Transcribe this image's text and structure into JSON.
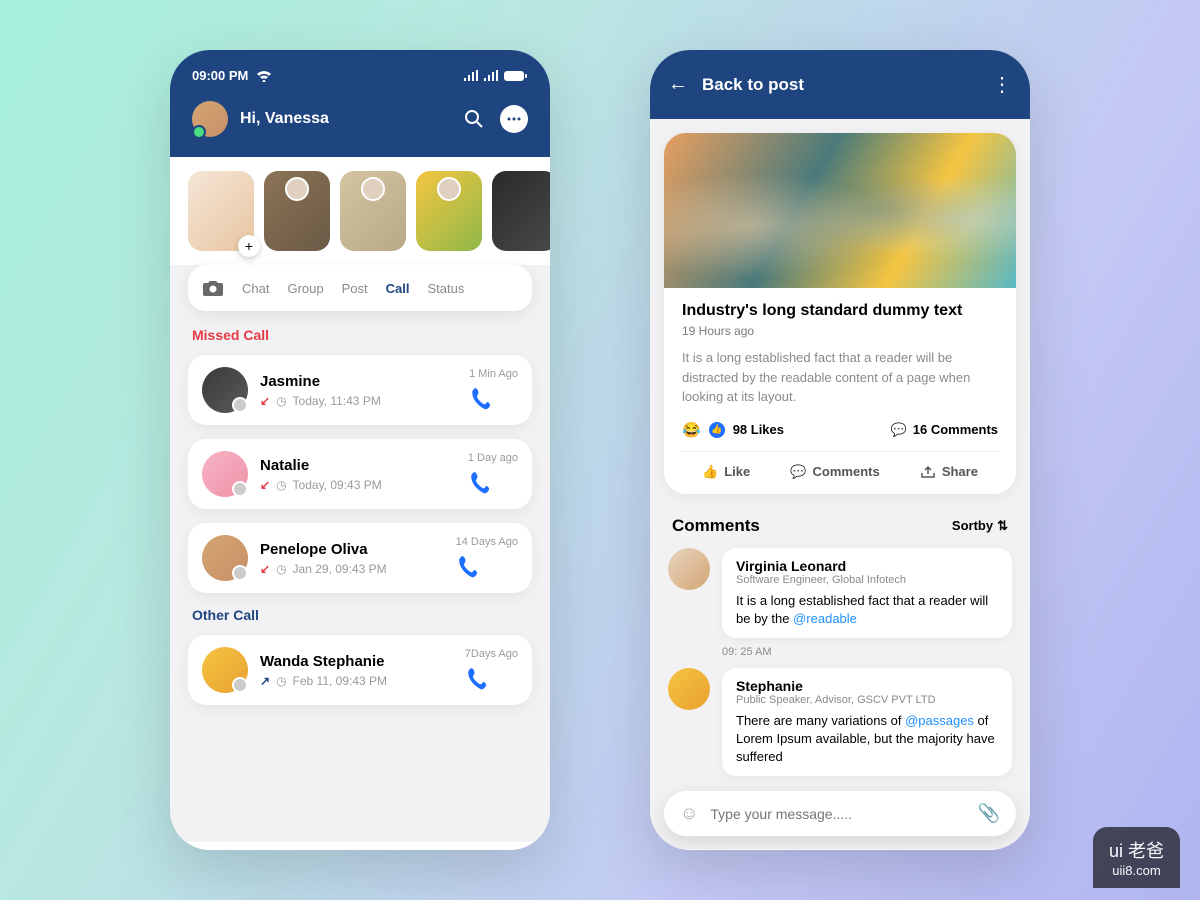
{
  "phone1": {
    "status_time": "09:00 PM",
    "greeting": "Hi, Vanessa",
    "tabs": {
      "chat": "Chat",
      "group": "Group",
      "post": "Post",
      "call": "Call",
      "status": "Status"
    },
    "missed_header": "Missed Call",
    "other_header": "Other Call",
    "calls_missed": [
      {
        "name": "Jasmine",
        "meta": "Today, 11:43 PM",
        "ago": "1 Min Ago",
        "dir": "missed"
      },
      {
        "name": "Natalie",
        "meta": "Today, 09:43 PM",
        "ago": "1 Day ago",
        "dir": "missed"
      },
      {
        "name": "Penelope Oliva",
        "meta": "Jan 29, 09:43 PM",
        "ago": "14 Days Ago",
        "dir": "missed"
      }
    ],
    "calls_other": [
      {
        "name": "Wanda Stephanie",
        "meta": "Feb 11, 09:43 PM",
        "ago": "7Days Ago",
        "dir": "out"
      }
    ]
  },
  "phone2": {
    "back_label": "Back to post",
    "post": {
      "title": "Industry's long standard dummy text",
      "time": "19 Hours ago",
      "desc": "It is a long established fact that a reader will be distracted by the readable content of a page when looking at its layout.",
      "likes": "98 Likes",
      "comments_count": "16 Comments",
      "actions": {
        "like": "Like",
        "comments": "Comments",
        "share": "Share"
      }
    },
    "comments_header": "Comments",
    "sortby": "Sortby",
    "comments": [
      {
        "user": "Virginia Leonard",
        "role": "Software Engineer, Global Infotech",
        "text_a": "It is a long established fact that a reader will be by the ",
        "mention": "@readable",
        "time": "09: 25 AM"
      },
      {
        "user": "Stephanie",
        "role": "Public Speaker, Advisor, GSCV PVT LTD",
        "text_a": "There are many variations of ",
        "mention": "@passages",
        "text_b": " of Lorem Ipsum available, but the majority have suffered"
      }
    ],
    "input_placeholder": "Type your message....."
  },
  "watermark": {
    "line1": "ui 老爸",
    "line2": "uii8.com"
  }
}
